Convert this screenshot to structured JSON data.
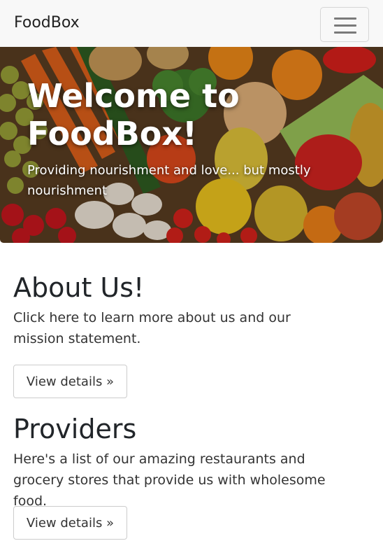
{
  "navbar": {
    "brand": "FoodBox",
    "toggle_icon": "hamburger-icon"
  },
  "hero": {
    "title": "Welcome to FoodBox!",
    "subtitle": "Providing nourishment and love... but mostly nourishment",
    "image": "vegetables-and-fruits-image"
  },
  "sections": [
    {
      "heading": "About Us!",
      "text": "Click here to learn more about us and our mission statement.",
      "button": "View details »"
    },
    {
      "heading": "Providers",
      "text": "Here's a list of our amazing restaurants and grocery stores that provide us with wholesome food.",
      "button": "View details »"
    }
  ]
}
